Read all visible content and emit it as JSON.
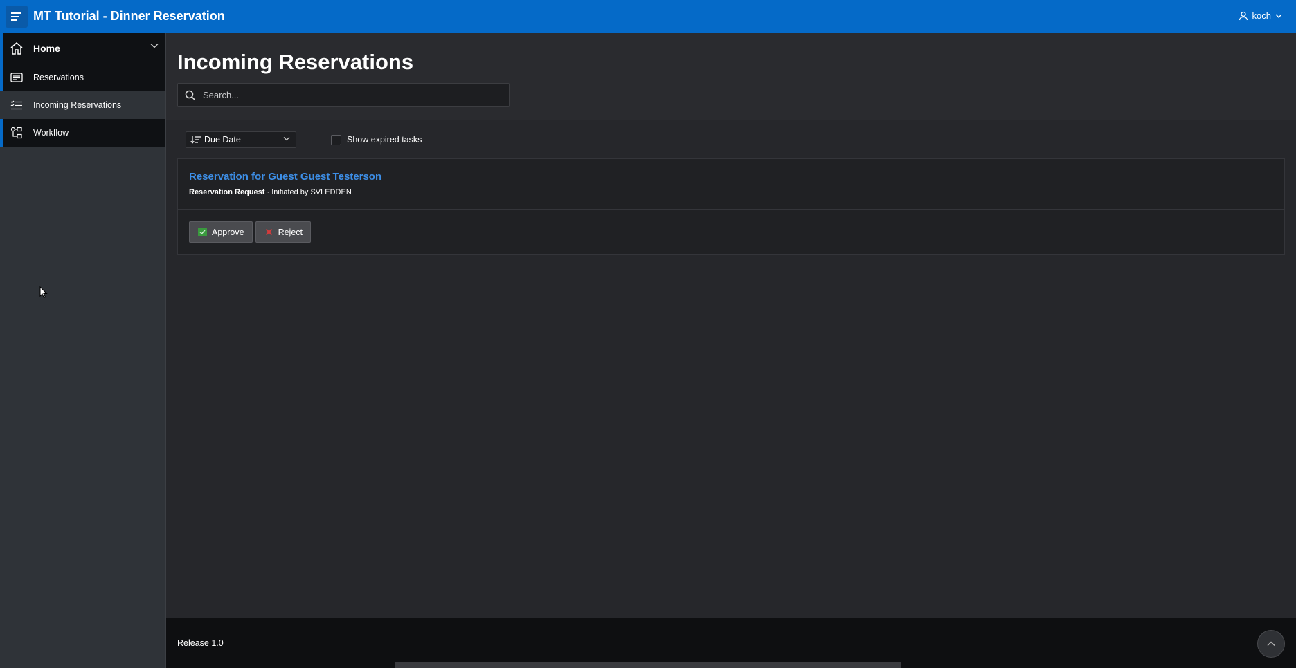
{
  "header": {
    "app_title": "MT Tutorial - Dinner Reservation",
    "user_name": "koch",
    "accent_color": "#056ac8"
  },
  "sidebar": {
    "items": [
      {
        "label": "Home",
        "icon": "home-icon"
      },
      {
        "label": "Reservations",
        "icon": "list-icon"
      },
      {
        "label": "Incoming Reservations",
        "icon": "checklist-icon",
        "active": true
      },
      {
        "label": "Workflow",
        "icon": "workflow-icon"
      }
    ]
  },
  "main": {
    "page_title": "Incoming Reservations",
    "search": {
      "placeholder": "Search..."
    },
    "sort": {
      "selected": "Due Date"
    },
    "show_expired": {
      "label": "Show expired tasks",
      "checked": false
    },
    "task": {
      "title": "Reservation for Guest Guest Testerson",
      "type": "Reservation Request",
      "initiated_by": " · Initiated by SVLEDDEN",
      "approve_label": "Approve",
      "reject_label": "Reject"
    }
  },
  "footer": {
    "release": "Release 1.0"
  }
}
